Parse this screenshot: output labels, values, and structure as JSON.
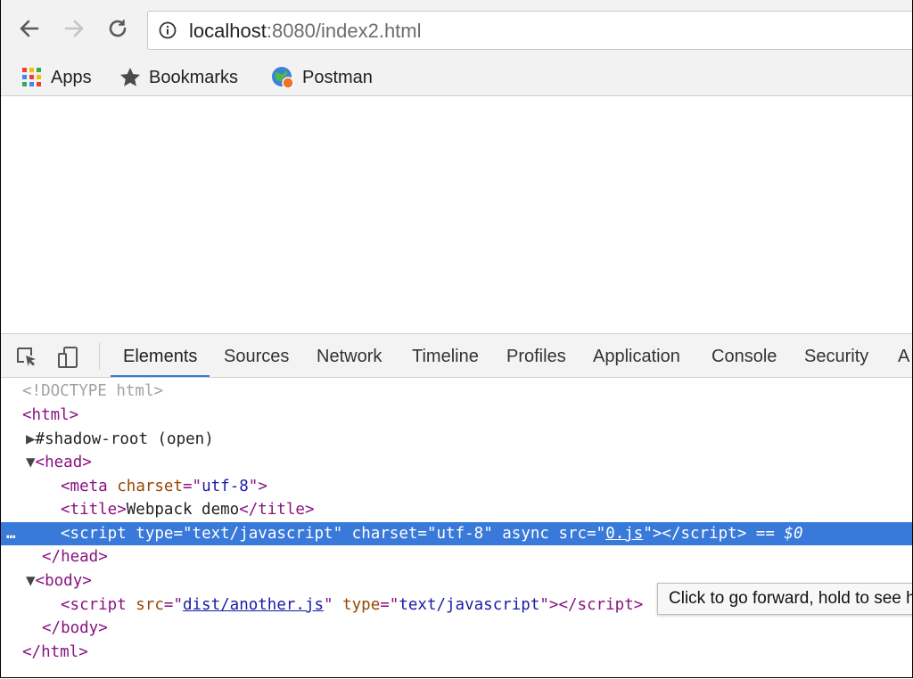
{
  "browser": {
    "url_host": "localhost",
    "url_rest": ":8080/index2.html",
    "bookmarks": [
      {
        "label": "Apps",
        "icon": "apps-grid-icon"
      },
      {
        "label": "Bookmarks",
        "icon": "star-icon"
      },
      {
        "label": "Postman",
        "icon": "postman-globe-icon"
      }
    ]
  },
  "devtools": {
    "tabs": [
      "Elements",
      "Sources",
      "Network",
      "Timeline",
      "Profiles",
      "Application",
      "Console",
      "Security",
      "A"
    ],
    "active_tab": "Elements",
    "dom": {
      "doctype": "<!DOCTYPE html>",
      "html_open": "<html>",
      "shadow_root": "#shadow-root (open)",
      "head_open": "<head>",
      "meta": {
        "tag": "meta",
        "attr": "charset",
        "value": "utf-8"
      },
      "title": {
        "text": "Webpack demo"
      },
      "selected_script": {
        "type": "text/javascript",
        "charset": "utf-8",
        "async": "async",
        "src": "0.js",
        "marker": "== $0"
      },
      "head_close": "</head>",
      "body_open": "<body>",
      "body_script": {
        "src": "dist/another.js",
        "type": "text/javascript"
      },
      "body_close": "</body>",
      "html_close": "</html>"
    },
    "tooltip": "Click to go forward, hold to see history"
  },
  "colors": {
    "accent": "#3879d9",
    "tag": "#881280",
    "attr": "#994500",
    "value": "#1a1aa6"
  }
}
